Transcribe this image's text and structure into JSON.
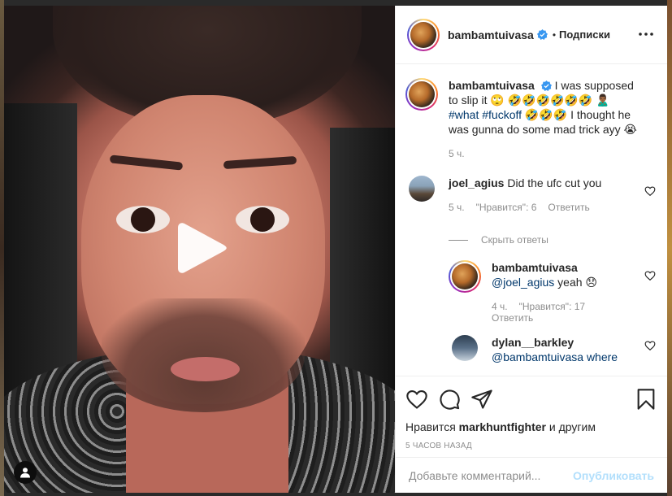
{
  "post": {
    "username": "bambamtuivasa",
    "follow_status": "Подписки",
    "dot": "•",
    "caption": {
      "part1": "I was supposed to slip it 🙄 🤣🤣🤣🤣🤣🤣 🙎🏾‍♂️",
      "hashtags": "#what #fuckoff",
      "part2": "🤣🤣🤣 I thought he was gunna do some mad trick ayy 😭",
      "time": "5 ч."
    },
    "comments": [
      {
        "username": "joel_agius",
        "text": "Did the ufc cut you",
        "time": "5 ч.",
        "likes": "\"Нравится\": 6",
        "reply_label": "Ответить"
      }
    ],
    "hide_replies_label": "Скрыть ответы",
    "replies": [
      {
        "username": "bambamtuivasa",
        "mention": "@joel_agius",
        "text": "yeah 😞",
        "time": "4 ч.",
        "likes": "\"Нравится\": 17",
        "reply_label": "Ответить"
      },
      {
        "username": "dylan__barkley",
        "mention": "@bambamtuivasa",
        "text": "where"
      }
    ],
    "liked_by_prefix": "Нравится",
    "liked_by_user": "markhuntfighter",
    "liked_by_suffix": "и другим",
    "timestamp": "5 часов назад",
    "comment_placeholder": "Добавьте комментарий...",
    "publish_label": "Опубликовать"
  },
  "colors": {
    "verified": "#3897f0",
    "link": "#00376b",
    "publish_disabled": "#b2dffc",
    "muted": "#8e8e8e"
  }
}
